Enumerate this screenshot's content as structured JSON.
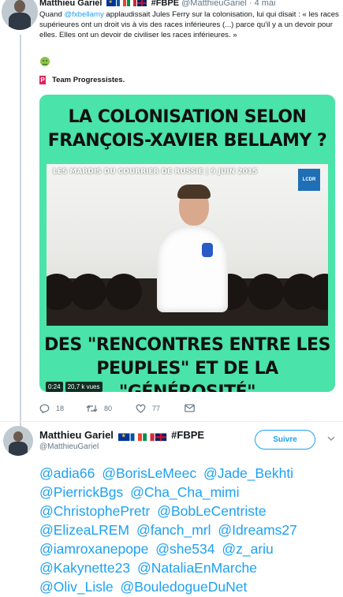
{
  "tweet1": {
    "author_name": "Matthieu Gariel",
    "hashtag": "#FBPE",
    "handle_date": "@MatthieuGariel · 4 mai",
    "text_pre": "Quand ",
    "text_mention": "@fxbellamy",
    "text_post": " applaudissait Jules Ferry sur la colonisation, lui qui disait : « les races supérieures ont un droit vis à vis des races inférieures (...) parce qu'il y a un devoir pour elles. Elles ont un devoir de civiliser les races inférieures. »",
    "team_label": "Team Progressistes.",
    "team_logo": "P",
    "video": {
      "title_line1": "LA COLONISATION SELON",
      "title_line2": "FRANÇOIS-XAVIER BELLAMY ?",
      "banner": "LES MARDIS DU COURRIER DE RUSSIE  |  9 JUIN 2015",
      "logo": "LCDR",
      "bottom_line1": "DES \"RENCONTRES ENTRE LES",
      "bottom_line2": "PEUPLES\" ET DE LA \"GÉNÉROSITÉ\"",
      "duration": "0:24",
      "views": "20,7 k vues"
    },
    "actions": {
      "reply_count": "18",
      "retweet_count": "80",
      "like_count": "77"
    }
  },
  "tweet2": {
    "author_name": "Matthieu Gariel",
    "hashtag": "#FBPE",
    "handle": "@MatthieuGariel",
    "follow_label": "Suivre",
    "mentions": [
      "@adia66",
      "@BorisLeMeec",
      "@Jade_Bekhti",
      "@PierrickBgs",
      "@Cha_Cha_mimi",
      "@ChristophePretr",
      "@BobLeCentriste",
      "@ElizeaLREM",
      "@fanch_mrl",
      "@Idreams27",
      "@iamroxanepope",
      "@she534",
      "@z_ariu",
      "@Kakynette23",
      "@NataliaEnMarche",
      "@Oliv_Lisle",
      "@BouledogueDuNet"
    ]
  },
  "colors": {
    "link": "#1da1f2",
    "video_bg": "#4ae3aa",
    "muted": "#657786"
  },
  "icons": [
    "reply-icon",
    "retweet-icon",
    "like-icon",
    "dm-icon",
    "chevron-down-icon",
    "smiley-emoji-icon"
  ]
}
